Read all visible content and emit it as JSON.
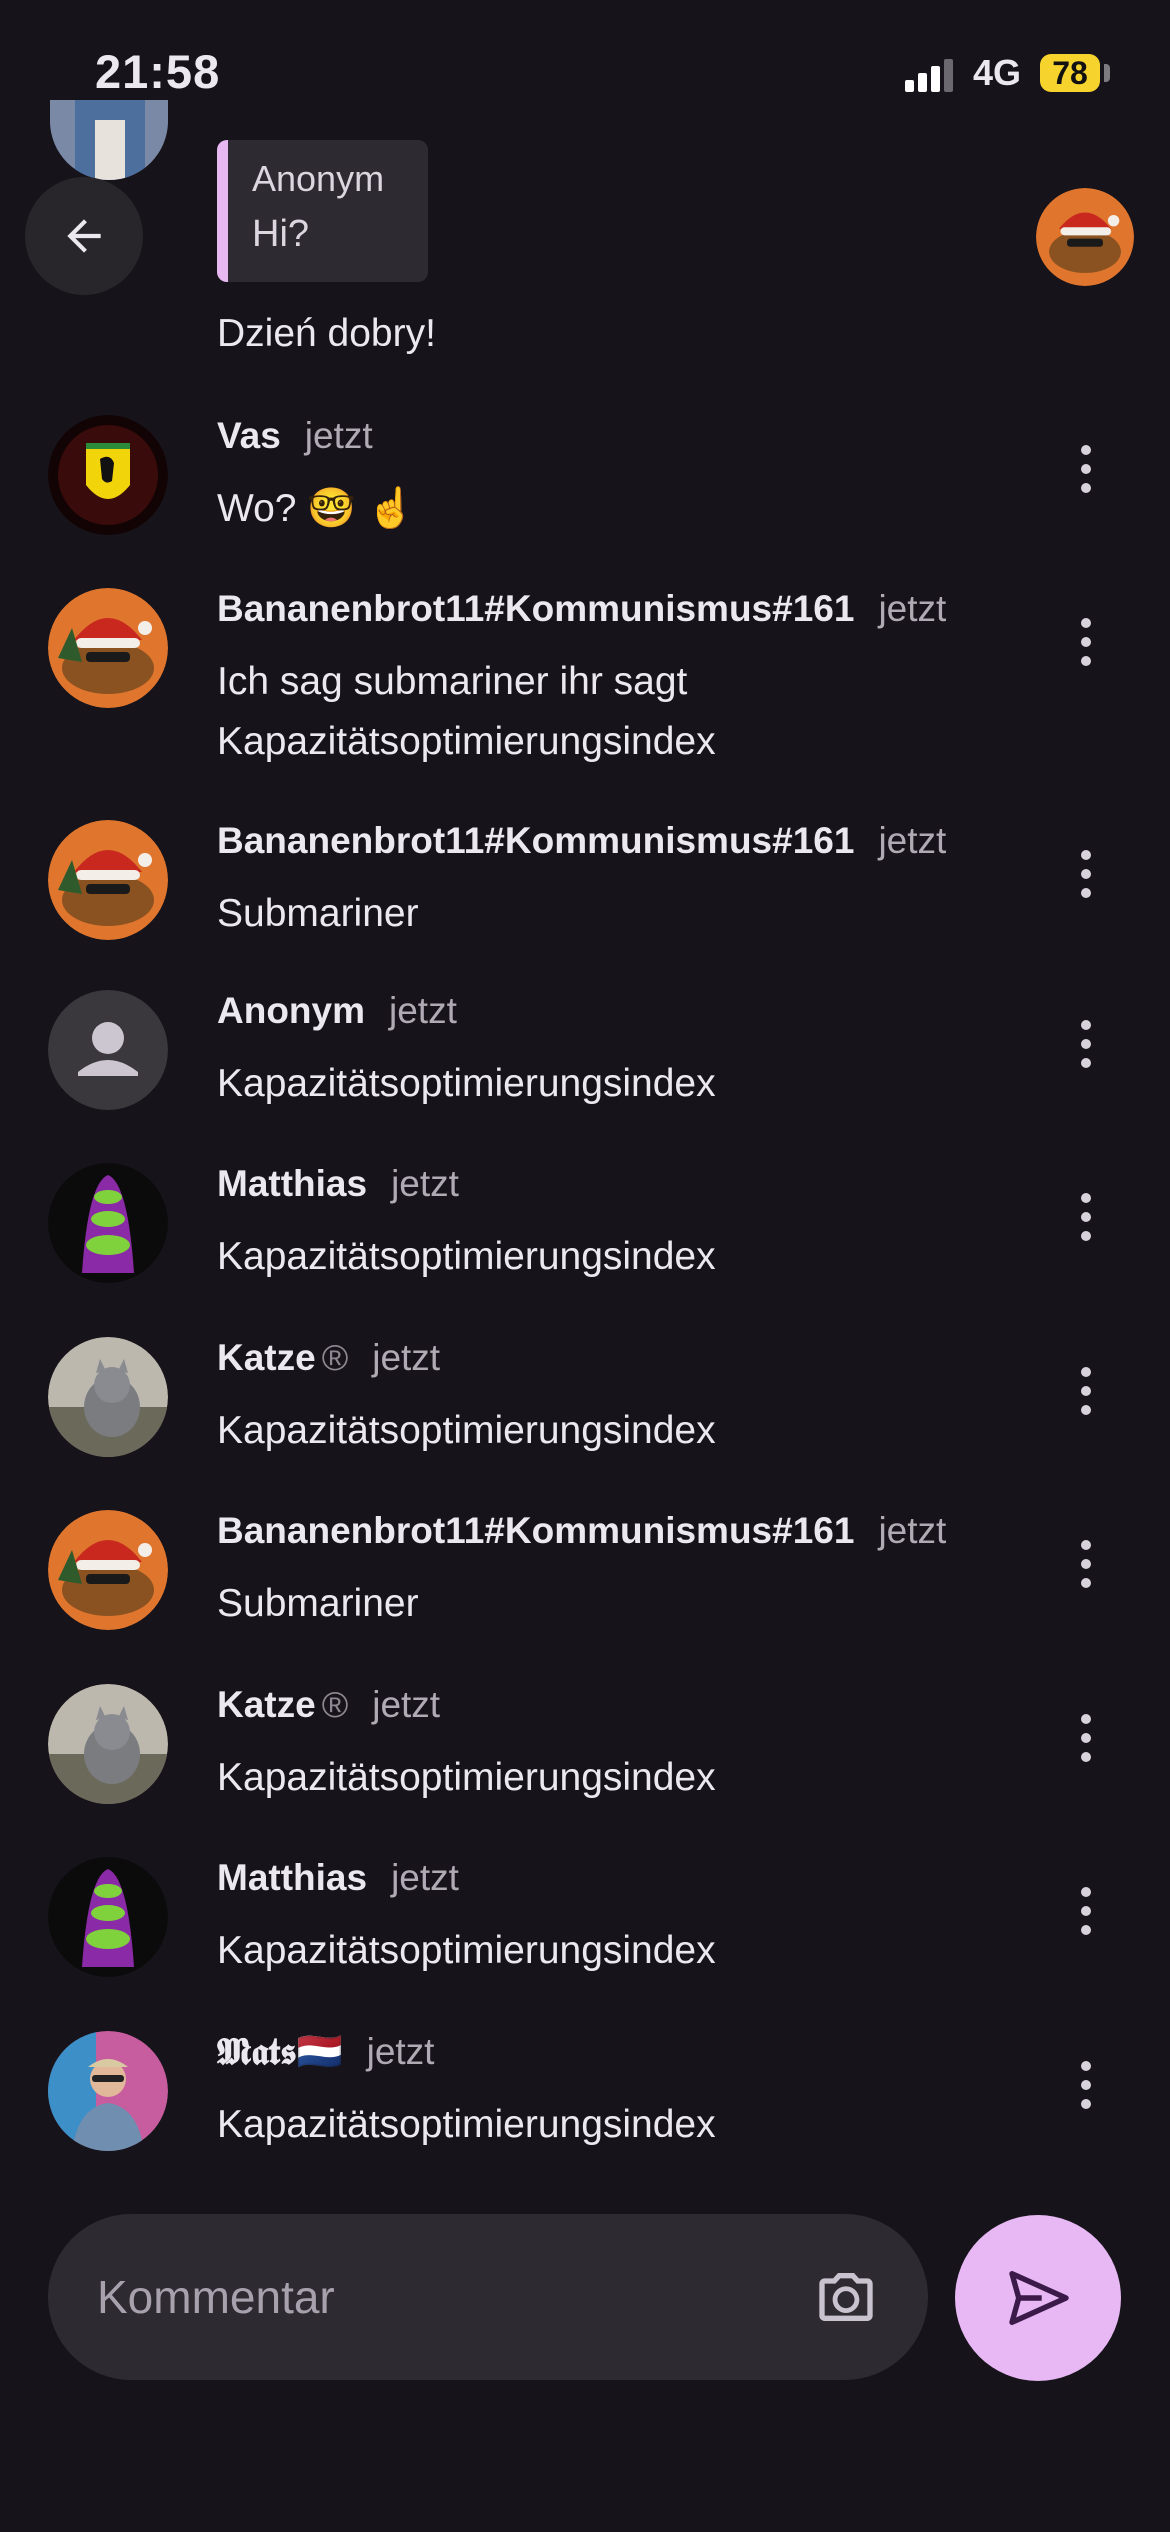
{
  "status_bar": {
    "time": "21:58",
    "network": "4G",
    "battery": "78"
  },
  "quoted": {
    "author": "Anonym",
    "text": "Hi?"
  },
  "peek_message": {
    "text": "Dzień dobry!"
  },
  "messages": [
    {
      "name": "Vas",
      "time": "jetzt",
      "text": "Wo? 🤓 ☝️",
      "avatar": "ferrari"
    },
    {
      "name": "Bananenbrot11#Kommunismus#161",
      "time": "jetzt",
      "text": "Ich sag submariner ihr sagt Kapazitätsoptimierungsindex",
      "avatar": "santa"
    },
    {
      "name": "Bananenbrot11#Kommunismus#161",
      "time": "jetzt",
      "text": "Submariner",
      "avatar": "santa"
    },
    {
      "name": "Anonym",
      "time": "jetzt",
      "text": "Kapazitätsoptimierungsindex",
      "avatar": "anon"
    },
    {
      "name": "Matthias",
      "time": "jetzt",
      "text": "Kapazitätsoptimierungsindex",
      "avatar": "tentacle"
    },
    {
      "name": "Katze",
      "badge": "®",
      "time": "jetzt",
      "text": "Kapazitätsoptimierungsindex",
      "avatar": "cat"
    },
    {
      "name": "Bananenbrot11#Kommunismus#161",
      "time": "jetzt",
      "text": "Submariner",
      "avatar": "santa"
    },
    {
      "name": "Katze",
      "badge": "®",
      "time": "jetzt",
      "text": "Kapazitätsoptimierungsindex",
      "avatar": "cat"
    },
    {
      "name": "Matthias",
      "time": "jetzt",
      "text": "Kapazitätsoptimierungsindex",
      "avatar": "tentacle"
    },
    {
      "name": "𝕸𝖆𝖙𝖘🇳🇱",
      "time": "jetzt",
      "text": "Kapazitätsoptimierungsindex",
      "avatar": "person"
    }
  ],
  "composer": {
    "placeholder": "Kommentar"
  },
  "icons": {
    "back": "arrow-left-icon",
    "more": "more-vert-icon",
    "camera": "camera-icon",
    "send": "send-icon"
  },
  "colors": {
    "background": "#16131a",
    "accent": "#e7b8f4",
    "battery": "#f6d32d"
  }
}
